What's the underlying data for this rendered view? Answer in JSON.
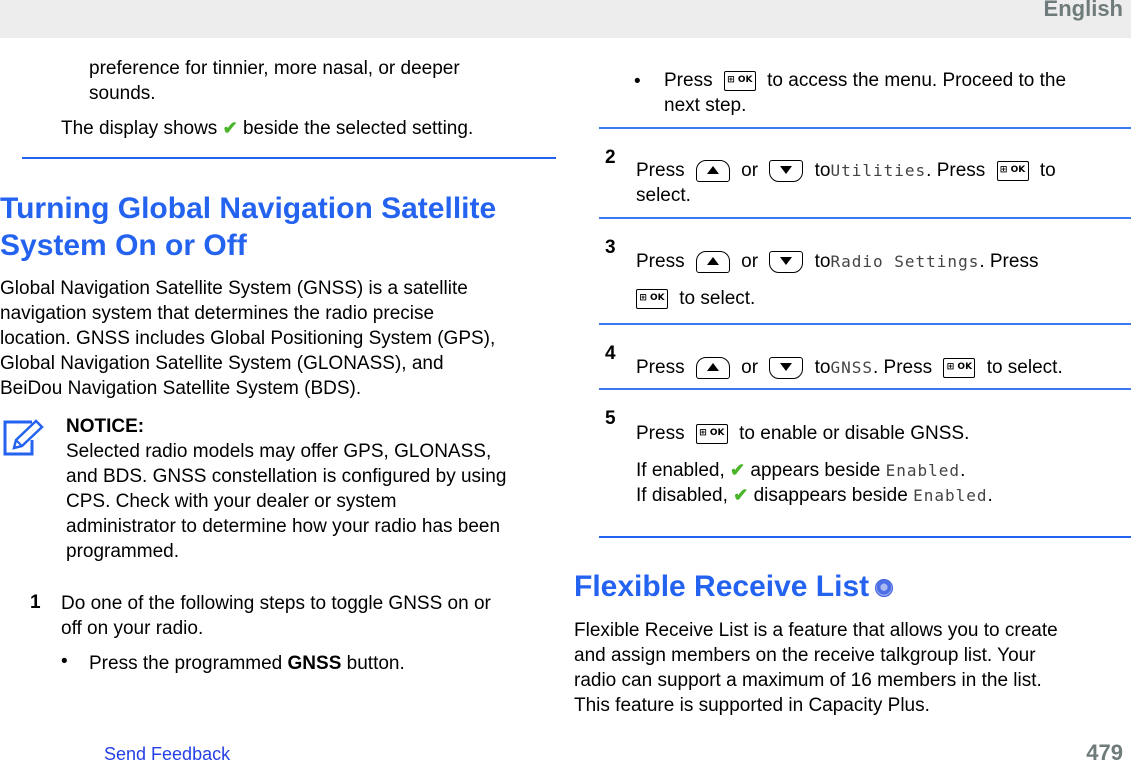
{
  "header": {
    "language": "English"
  },
  "left": {
    "intro_line1": "preference for tinnier, more nasal, or deeper",
    "intro_line2": "sounds.",
    "display_prefix": "The display shows",
    "display_suffix": "beside the selected setting.",
    "title_line1": "Turning Global Navigation Satellite",
    "title_line2": "System On or Off",
    "desc": [
      "Global Navigation Satellite System (GNSS) is a satellite",
      "navigation system that determines the radio precise",
      "location. GNSS includes Global Positioning System (GPS),",
      "Global Navigation Satellite System (GLONASS), and",
      "BeiDou Navigation Satellite System (BDS)."
    ],
    "notice": {
      "label": "NOTICE:",
      "lines": [
        "Selected radio models may offer GPS, GLONASS,",
        "and BDS. GNSS constellation is configured by using",
        "CPS. Check with your dealer or system",
        "administrator to determine how your radio has been",
        "programmed."
      ]
    },
    "step1": {
      "num": "1",
      "line1": "Do one of the following steps to toggle GNSS on or",
      "line2": "off on your radio.",
      "bullet_prefix": "Press the programmed",
      "bullet_bold": "GNSS",
      "bullet_suffix": "button."
    }
  },
  "right": {
    "bullet2": {
      "prefix": "Press",
      "suffix": "to access the menu. Proceed to the",
      "line2": "next step."
    },
    "steps": [
      {
        "num": "2",
        "press": "Press",
        "or": "or",
        "to": "to",
        "menu": "Utilities",
        "after": ". Press",
        "end": "to",
        "line2": "select."
      },
      {
        "num": "3",
        "press": "Press",
        "or": "or",
        "to": "to",
        "menu": "Radio Settings",
        "after": ". Press",
        "line2": "to select."
      },
      {
        "num": "4",
        "press": "Press",
        "or": "or",
        "to": "to",
        "menu": "GNSS",
        "after": ". Press",
        "end": "to select."
      },
      {
        "num": "5",
        "press": "Press",
        "end": "to enable or disable GNSS.",
        "enabled_prefix": "If enabled,",
        "enabled_mid": "appears beside",
        "enabled_menu": "Enabled",
        "disabled_prefix": "If disabled,",
        "disabled_mid": "disappears beside",
        "disabled_menu": "Enabled"
      }
    ],
    "ok_key": "⊞ OK",
    "check_glyph": "✔",
    "frl_title": "Flexible Receive List",
    "frl_desc": [
      "Flexible Receive List is a feature that allows you to create",
      "and assign members on the receive talkgroup list. Your",
      "radio can support a maximum of 16 members in the list.",
      "This feature is supported in Capacity Plus."
    ]
  },
  "footer": {
    "feedback": "Send Feedback",
    "page": "479"
  },
  "colors": {
    "accent": "#2463f0",
    "check": "#4ab52a",
    "gray": "#6f7b7b",
    "link": "#2440e6"
  }
}
